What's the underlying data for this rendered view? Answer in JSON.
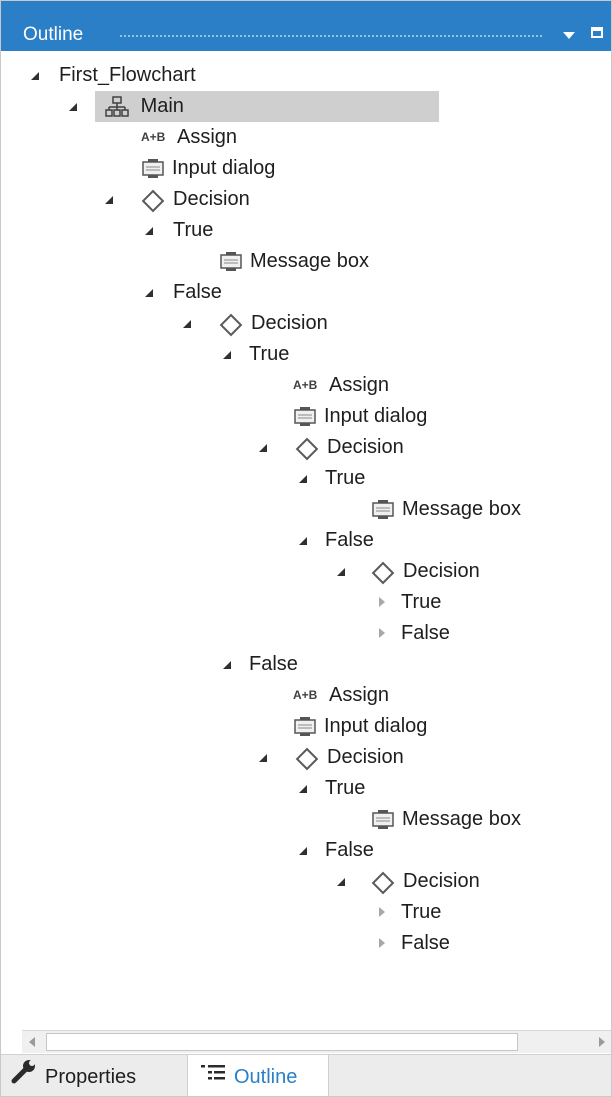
{
  "panel": {
    "title": "Outline"
  },
  "tree": {
    "root": "First_Flowchart",
    "main": "Main",
    "l1": {
      "assign": "Assign",
      "input": "Input dialog",
      "decision": "Decision",
      "true": "True",
      "true_msg": "Message box",
      "false": "False"
    },
    "l2": {
      "decision": "Decision",
      "true": "True",
      "false": "False"
    },
    "l3_true": {
      "assign": "Assign",
      "input": "Input dialog",
      "decision": "Decision",
      "true": "True",
      "true_msg": "Message box",
      "false": "False",
      "sub_decision": "Decision",
      "sub_true": "True",
      "sub_false": "False"
    },
    "l3_false": {
      "assign": "Assign",
      "input": "Input dialog",
      "decision": "Decision",
      "true": "True",
      "true_msg": "Message box",
      "false": "False",
      "sub_decision": "Decision",
      "sub_true": "True",
      "sub_false": "False"
    },
    "assign_icon_text": "A+B"
  },
  "tabs": {
    "properties": "Properties",
    "outline": "Outline"
  },
  "colors": {
    "accent": "#2a7fc6",
    "selection": "#cfcfcf"
  }
}
